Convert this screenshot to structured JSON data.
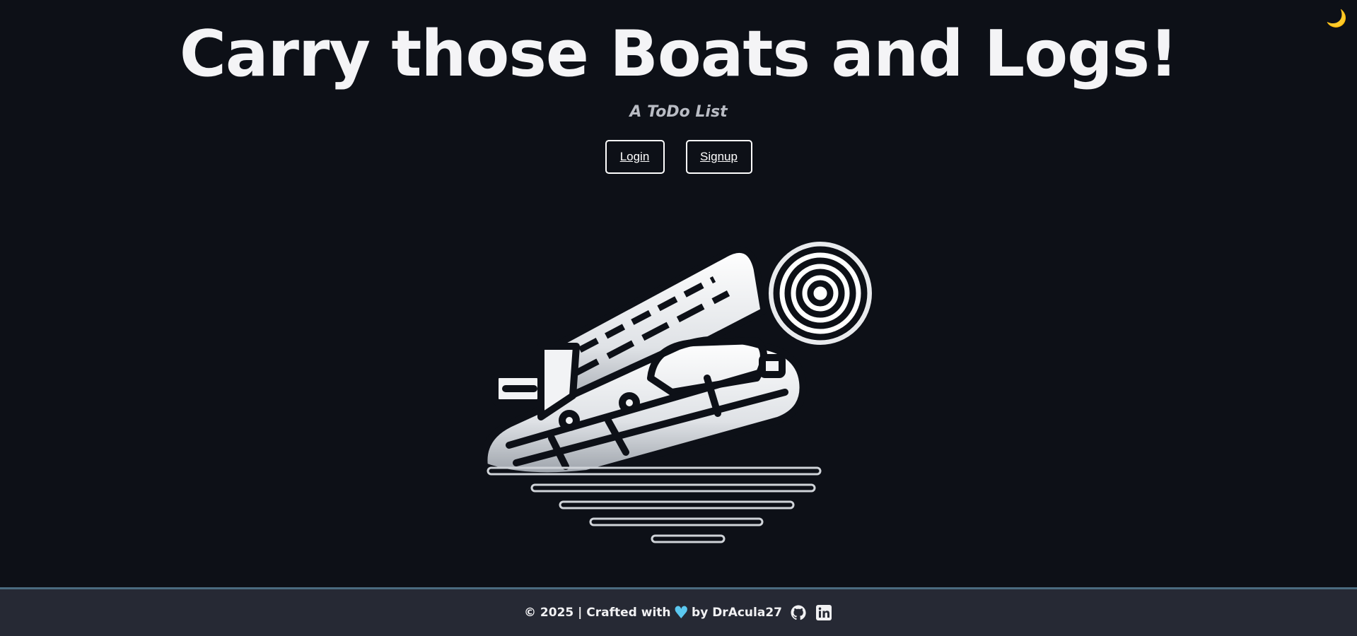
{
  "header": {
    "title": "Carry those Boats and Logs!",
    "subtitle": "A ToDo List",
    "theme_toggle_icon": "moon-icon"
  },
  "auth": {
    "login_label": "Login",
    "signup_label": "Signup"
  },
  "hero": {
    "icon": "boat-and-log-illustration"
  },
  "footer": {
    "prefix": "© 2025 | Crafted with",
    "heart_icon": "heart-icon",
    "suffix": "by DrAcula27",
    "links": [
      "github-icon",
      "linkedin-icon"
    ]
  },
  "colors": {
    "background": "#0d1017",
    "footer_background": "#262934",
    "footer_border": "#4a6b80",
    "heart": "#5bc8f0",
    "moon": "#f4c542"
  }
}
